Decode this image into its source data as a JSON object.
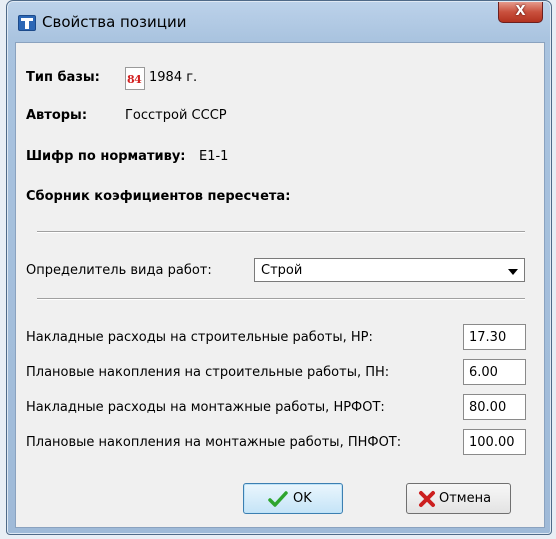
{
  "window": {
    "title": "Свойства позиции",
    "close_label": "X"
  },
  "base": {
    "label": "Тип базы:",
    "icon_text": "84",
    "year": "1984 г."
  },
  "authors": {
    "label": "Авторы:",
    "value": "Госстрой СССР"
  },
  "cipher": {
    "label": "Шифр по нормативу:",
    "value": "Е1-1"
  },
  "coefficients": {
    "label": "Сборник коэфициентов пересчета:"
  },
  "work_type": {
    "label": "Определитель вида работ:",
    "selected": "Строй"
  },
  "rates": [
    {
      "label": "Накладные расходы на строительные работы, НР:",
      "value": "17.30"
    },
    {
      "label": "Плановые накопления на строительные работы, ПН:",
      "value": "6.00"
    },
    {
      "label": "Накладные расходы на монтажные работы, НРФОТ:",
      "value": "80.00"
    },
    {
      "label": "Плановые накопления на монтажные работы, ПНФОТ:",
      "value": "100.00"
    }
  ],
  "buttons": {
    "ok": "OK",
    "cancel": "Отмена"
  },
  "colors": {
    "ok_check": "#2ea52e",
    "cancel_x": "#cc1f1f",
    "icon_red": "#d22020"
  }
}
